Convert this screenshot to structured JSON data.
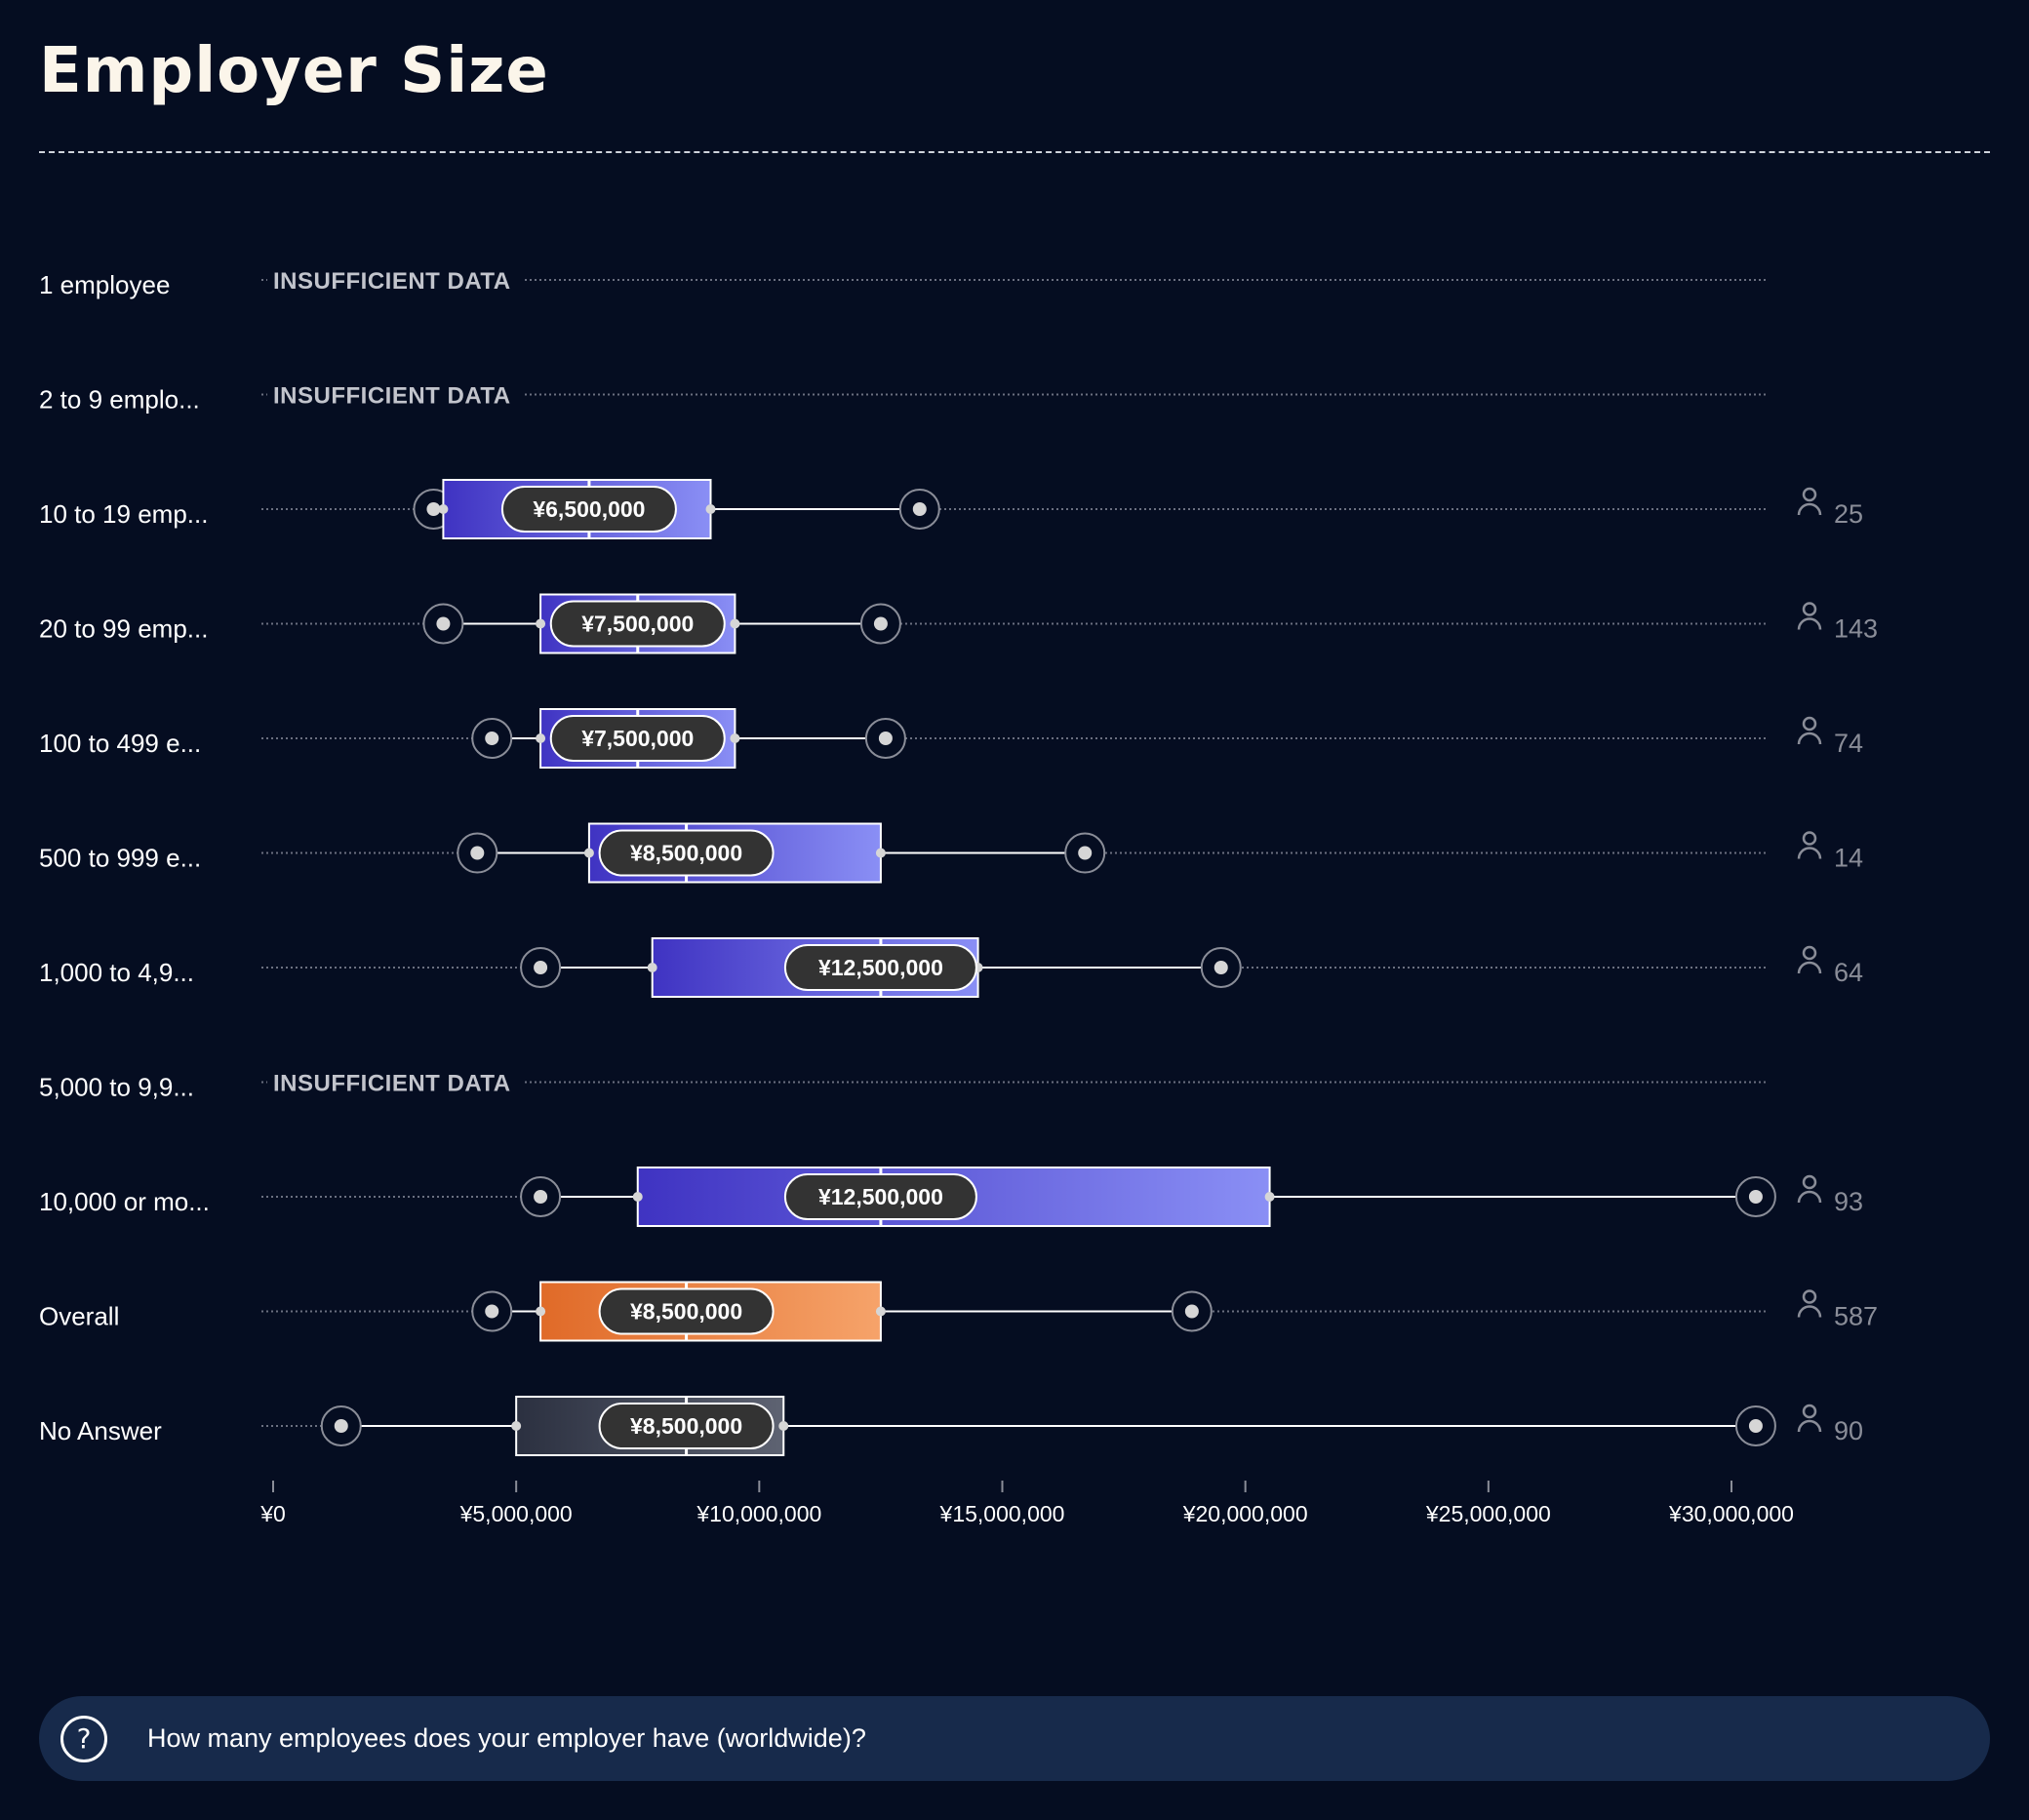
{
  "title": "Employer Size",
  "question": "How many employees does your employer have (worldwide)?",
  "colors": {
    "background": "#050d21",
    "box_blue_start": "#3f33c2",
    "box_blue_end": "#8a8ff5",
    "box_orange_start": "#e06a28",
    "box_orange_end": "#f6a36a",
    "box_gray_start": "#2b3040",
    "box_gray_end": "#5e6372",
    "label_pill": "#333333",
    "footer": "#172a4b"
  },
  "icons": {
    "respondents": "person-icon",
    "help": "question-circle-icon"
  },
  "chart_data": {
    "type": "boxplot",
    "orientation": "horizontal",
    "xlim": [
      0,
      31000000
    ],
    "x_ticks": [
      0,
      5000000,
      10000000,
      15000000,
      20000000,
      25000000,
      30000000
    ],
    "x_tick_labels": [
      "¥0",
      "¥5,000,000",
      "¥10,000,000",
      "¥15,000,000",
      "¥20,000,000",
      "¥25,000,000",
      "¥30,000,000"
    ],
    "insufficient_label": "INSUFFICIENT DATA",
    "rows": [
      {
        "label": "1 employee",
        "insufficient": true
      },
      {
        "label": "2 to 9 emplo...",
        "insufficient": true
      },
      {
        "label": "10 to 19 emp...",
        "style": "blue",
        "whisker_low": 3300000,
        "q1": 3500000,
        "median": 6500000,
        "q3": 9000000,
        "whisker_high": 13300000,
        "median_label": "¥6,500,000",
        "count": "25"
      },
      {
        "label": "20 to 99 emp...",
        "style": "blue",
        "whisker_low": 3500000,
        "q1": 5500000,
        "median": 7500000,
        "q3": 9500000,
        "whisker_high": 12500000,
        "median_label": "¥7,500,000",
        "count": "143"
      },
      {
        "label": "100 to 499 e...",
        "style": "blue",
        "whisker_low": 4500000,
        "q1": 5500000,
        "median": 7500000,
        "q3": 9500000,
        "whisker_high": 12600000,
        "median_label": "¥7,500,000",
        "count": "74"
      },
      {
        "label": "500 to 999 e...",
        "style": "blue",
        "whisker_low": 4200000,
        "q1": 6500000,
        "median": 8500000,
        "q3": 12500000,
        "whisker_high": 16700000,
        "median_label": "¥8,500,000",
        "count": "14"
      },
      {
        "label": "1,000 to 4,9...",
        "style": "blue",
        "whisker_low": 5500000,
        "q1": 7800000,
        "median": 12500000,
        "q3": 14500000,
        "whisker_high": 19500000,
        "median_label": "¥12,500,000",
        "count": "64"
      },
      {
        "label": "5,000 to 9,9...",
        "insufficient": true
      },
      {
        "label": "10,000 or mo...",
        "style": "blue",
        "whisker_low": 5500000,
        "q1": 7500000,
        "median": 12500000,
        "q3": 20500000,
        "whisker_high": 30500000,
        "median_label": "¥12,500,000",
        "count": "93"
      },
      {
        "label": "Overall",
        "style": "orange",
        "whisker_low": 4500000,
        "q1": 5500000,
        "median": 8500000,
        "q3": 12500000,
        "whisker_high": 18900000,
        "median_label": "¥8,500,000",
        "count": "587"
      },
      {
        "label": "No Answer",
        "style": "gray",
        "whisker_low": 1400000,
        "q1": 5000000,
        "median": 8500000,
        "q3": 10500000,
        "whisker_high": 30500000,
        "median_label": "¥8,500,000",
        "count": "90"
      }
    ]
  }
}
